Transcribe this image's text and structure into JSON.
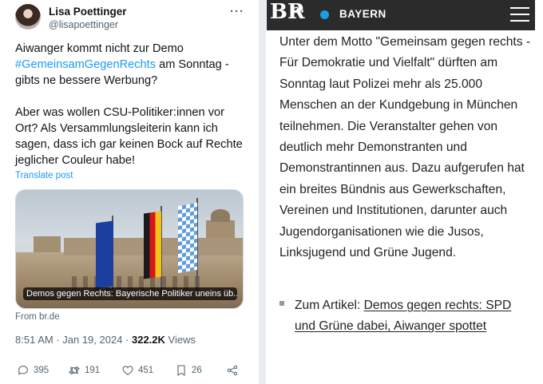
{
  "tweet": {
    "display_name": "Lisa Poettinger",
    "handle": "@lisapoettinger",
    "text_before": "Aiwanger kommt nicht zur Demo\n",
    "hashtag": "#GemeinsamGegenRechts",
    "text_after": " am Sonntag - gibts ne bessere Werbung?\n\nAber was wollen CSU-Politiker:innen vor Ort? Als Versammlungsleiterin kann ich sagen, dass ich gar keinen Bock auf Rechte jeglicher Couleur habe!",
    "translate_label": "Translate post",
    "card_caption": "Demos gegen Rechts: Bayerische Politiker uneins üb...",
    "card_source": "From br.de",
    "timestamp": "8:51 AM · Jan 19, 2024 · ",
    "views_count": "322.2K",
    "views_label": " Views",
    "actions": {
      "replies": "395",
      "reposts": "191",
      "likes": "451",
      "bookmarks": "26"
    }
  },
  "article": {
    "region": "BAYERN",
    "logo": "BR",
    "logo_sup": "24",
    "body": "Unter dem Motto \"Gemeinsam gegen rechts - Für Demokratie und Vielfalt\" dürften am Sonntag laut Polizei mehr als 25.000 Menschen an der Kundgebung in München teilnehmen. Die Veranstalter gehen von deutlich mehr Demonstranten und Demonstrantinnen aus. Dazu aufgerufen hat ein breites Bündnis aus Gewerkschaften, Vereinen und Institutionen, darunter auch Jugendorganisationen wie die Jusos, Linksjugend und Grüne Jugend.",
    "related_prefix": "Zum Artikel: ",
    "related_link": "Demos gegen rechts: SPD und Grüne dabei, Aiwanger spottet"
  },
  "colors": {
    "link_blue": "#1d9bf0",
    "br_header": "#2b2b2b",
    "br_live_dot": "#1a9fe0"
  }
}
